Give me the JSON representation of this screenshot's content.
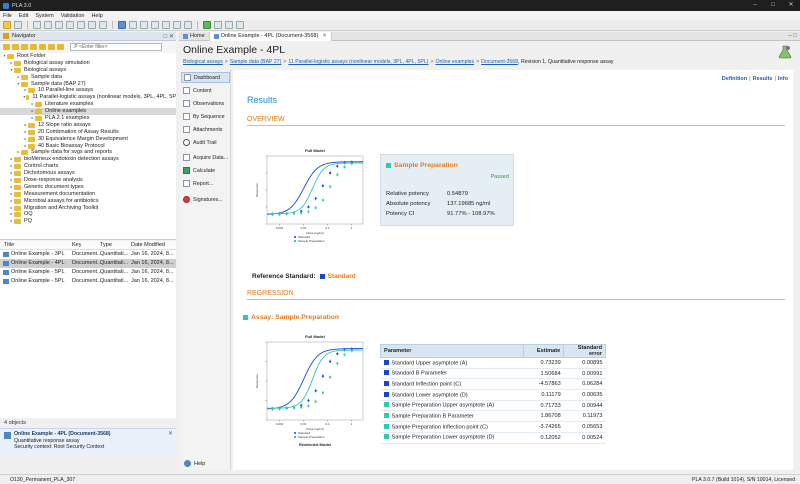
{
  "window": {
    "title": "PLA 3.0"
  },
  "menu": [
    "File",
    "Edit",
    "System",
    "Validation",
    "Help"
  ],
  "navigator": {
    "title": "Navigator",
    "filter_placeholder": ".P <Enter filter>",
    "tree": [
      {
        "label": "Root Folder",
        "level": 0,
        "expanded": true
      },
      {
        "label": "Biological assay simulation",
        "level": 1
      },
      {
        "label": "Biological assays",
        "level": 1,
        "expanded": true
      },
      {
        "label": "Sample data",
        "level": 2
      },
      {
        "label": "Sample data (BAP 27)",
        "level": 2,
        "expanded": true
      },
      {
        "label": "10 Parallel-line assays",
        "level": 3
      },
      {
        "label": "11 Parallel-logistic assays (nonlinear models, 3PL, 4PL, 5P",
        "level": 3,
        "expanded": true
      },
      {
        "label": "Literature examples",
        "level": 4
      },
      {
        "label": "Online examples",
        "level": 4,
        "selected": true
      },
      {
        "label": "PLA 2.1 examples",
        "level": 4
      },
      {
        "label": "12 Slope ratio assays",
        "level": 3
      },
      {
        "label": "20 Combination of Assay Results",
        "level": 3
      },
      {
        "label": "30 Equivalence Margin Development",
        "level": 3
      },
      {
        "label": "40 Basic Bioassay Protocol",
        "level": 3
      },
      {
        "label": "Sample data for svgs and reports",
        "level": 2
      },
      {
        "label": "bioMérieux endotoxin detection assays",
        "level": 1
      },
      {
        "label": "Control charts",
        "level": 1
      },
      {
        "label": "Dichotomous assays",
        "level": 1
      },
      {
        "label": "Dose-response analysis",
        "level": 1
      },
      {
        "label": "Generic document types",
        "level": 1
      },
      {
        "label": "Measurement documentation",
        "level": 1
      },
      {
        "label": "Microbial assays for antibiotics",
        "level": 1
      },
      {
        "label": "Migration and Archiving Toolkit",
        "level": 1
      },
      {
        "label": "OQ",
        "level": 1
      },
      {
        "label": "PQ",
        "level": 1
      }
    ],
    "list_headers": [
      "Title",
      "Key",
      "Type",
      "Date Modified"
    ],
    "list_rows": [
      [
        "Online Example - 3PL",
        "Document...",
        "Quantitati...",
        "Jan 16, 2024, 8..."
      ],
      [
        "Online Example - 4PL",
        "Document...",
        "Quantitati...",
        "Jan 16, 2024, 8..."
      ],
      [
        "Online Example - 5PL",
        "Document...",
        "Quantitati...",
        "Jan 16, 2024, 8..."
      ],
      [
        "Online Example - 5PL",
        "Document...",
        "Quantitati...",
        "Jan 16, 2024, 8..."
      ]
    ],
    "object_count": "4 objects",
    "summary": {
      "title": "Online Example - 4PL (Document-3568)",
      "line1": "Quantitative response assay",
      "line2": "Security context: Root Security Context"
    }
  },
  "tabs": [
    {
      "label": "Home",
      "active": false
    },
    {
      "label": "Online Example - 4PL (Document-3568)",
      "active": true
    }
  ],
  "document": {
    "title": "Online Example - 4PL",
    "breadcrumb": [
      "Biological assays",
      "Sample data (BAP 27)",
      "11 Parallel-logistic assays (nonlinear models, 3PL, 4PL, 5PL)",
      "Online examples",
      "Document-3568"
    ],
    "breadcrumb_tail": ", Revision 1, Quantitative response assay"
  },
  "sidenav": [
    {
      "label": "Dashboard",
      "icon": "dashboard-icon",
      "selected": true
    },
    {
      "label": "Content",
      "icon": "content-icon"
    },
    {
      "label": "Observations",
      "icon": "observations-icon"
    },
    {
      "label": "By Sequence",
      "icon": "sequence-icon"
    },
    {
      "label": "Attachments",
      "icon": "attachment-icon"
    },
    {
      "label": "Audit Trail",
      "icon": "audit-icon"
    },
    {
      "label": "Acquire Data...",
      "icon": "acquire-icon"
    },
    {
      "label": "Calculate",
      "icon": "calculate-icon"
    },
    {
      "label": "Report...",
      "icon": "report-icon"
    },
    {
      "label": "Signatures...",
      "icon": "signature-icon"
    }
  ],
  "help_label": "Help",
  "top_links": [
    "Definition",
    "Results",
    "Info"
  ],
  "results_title": "Results",
  "sections": {
    "overview": "OVERVIEW",
    "regression": "REGRESSION"
  },
  "sample_prep": {
    "title": "Sample Preparation",
    "status": "Passed",
    "rows": [
      {
        "label": "Relative potency",
        "value": "0.54879"
      },
      {
        "label": "Absolute potency",
        "value": "137.19685 ng/ml"
      },
      {
        "label": "Potency CI",
        "value": "91.77% - 108.97%"
      }
    ]
  },
  "reference_standard": {
    "label": "Reference Standard:",
    "value": "Standard"
  },
  "assay_label": "Assay: Sample Preparation",
  "params_table": {
    "headers": [
      "Parameter",
      "Estimate",
      "Standard error"
    ],
    "rows": [
      {
        "name": "Standard Upper asymptote (A)",
        "estimate": "0.73239",
        "se": "0.00895",
        "color": "#1846d2"
      },
      {
        "name": "Standard B Parameter",
        "estimate": "1.50684",
        "se": "0.00991",
        "color": "#1846d2"
      },
      {
        "name": "Standard Inflection point (C)",
        "estimate": "-4.57863",
        "se": "0.06284",
        "color": "#1846d2"
      },
      {
        "name": "Standard Lower asymptote (D)",
        "estimate": "0.11179",
        "se": "0.00635",
        "color": "#1846d2"
      },
      {
        "name": "Sample Preparation Upper asymptote (A)",
        "estimate": "0.71733",
        "se": "0.00944",
        "color": "#2ecbb0"
      },
      {
        "name": "Sample Preparation B Parameter",
        "estimate": "1.86708",
        "se": "0.11973",
        "color": "#2ecbb0"
      },
      {
        "name": "Sample Preparation Inflection point (C)",
        "estimate": "-3.74265",
        "se": "0.05653",
        "color": "#2ecbb0"
      },
      {
        "name": "Sample Preparation Lower asymptote (D)",
        "estimate": "0.12052",
        "se": "0.00524",
        "color": "#2ecbb0"
      }
    ]
  },
  "chart_data": [
    {
      "type": "scatter",
      "title": "Full Model",
      "xlabel": "Dose (ug/ml)",
      "ylabel": "Response",
      "x_ticks": [
        "0.001",
        "0.01",
        "0.1",
        "1"
      ],
      "xlim": [
        0.0003,
        3
      ],
      "ylim": [
        0,
        0.8
      ],
      "log_x": true,
      "series": [
        {
          "name": "Standard",
          "color": "#1846d2",
          "A": 0.73239,
          "B": 1.50684,
          "C": -4.57863,
          "D": 0.11179,
          "x": [
            0.0005,
            0.001,
            0.002,
            0.004,
            0.008,
            0.016,
            0.032,
            0.064,
            0.128,
            0.256,
            0.512,
            1.024
          ],
          "y": [
            0.115,
            0.118,
            0.122,
            0.13,
            0.15,
            0.2,
            0.3,
            0.45,
            0.6,
            0.68,
            0.72,
            0.73
          ]
        },
        {
          "name": "Sample Preparation",
          "color": "#2ecbb0",
          "A": 0.71733,
          "B": 1.86708,
          "C": -3.74265,
          "D": 0.12052,
          "x": [
            0.0005,
            0.001,
            0.002,
            0.004,
            0.008,
            0.016,
            0.032,
            0.064,
            0.128,
            0.256,
            0.512,
            1.024
          ],
          "y": [
            0.12,
            0.121,
            0.122,
            0.125,
            0.13,
            0.145,
            0.19,
            0.28,
            0.44,
            0.58,
            0.67,
            0.71
          ]
        }
      ]
    },
    {
      "type": "scatter",
      "title": "Full Model",
      "xlabel": "Dose (ug/ml)",
      "ylabel": "Response",
      "x_ticks": [
        "0.001",
        "0.01",
        "0.1",
        "1"
      ],
      "xlim": [
        0.0003,
        3
      ],
      "ylim": [
        0,
        0.8
      ],
      "log_x": true,
      "bottom_label": "Restricted Model",
      "series": [
        {
          "name": "Standard",
          "color": "#1846d2",
          "A": 0.73239,
          "B": 1.50684,
          "C": -4.57863,
          "D": 0.11179,
          "x": [
            0.0005,
            0.001,
            0.002,
            0.004,
            0.008,
            0.016,
            0.032,
            0.064,
            0.128,
            0.256,
            0.512,
            1.024
          ],
          "y": [
            0.115,
            0.118,
            0.122,
            0.13,
            0.15,
            0.2,
            0.3,
            0.45,
            0.6,
            0.68,
            0.72,
            0.73
          ]
        },
        {
          "name": "Sample Preparation",
          "color": "#2ecbb0",
          "A": 0.71733,
          "B": 1.86708,
          "C": -3.74265,
          "D": 0.12052,
          "x": [
            0.0005,
            0.001,
            0.002,
            0.004,
            0.008,
            0.016,
            0.032,
            0.064,
            0.128,
            0.256,
            0.512,
            1.024
          ],
          "y": [
            0.12,
            0.121,
            0.122,
            0.125,
            0.13,
            0.145,
            0.19,
            0.28,
            0.44,
            0.58,
            0.67,
            0.71
          ]
        }
      ]
    }
  ],
  "statusbar": {
    "left": "O130_Permanent_PLA_307",
    "right": "PLA 3.0.7 (Build 1014), S/N 10014, Licensed"
  }
}
